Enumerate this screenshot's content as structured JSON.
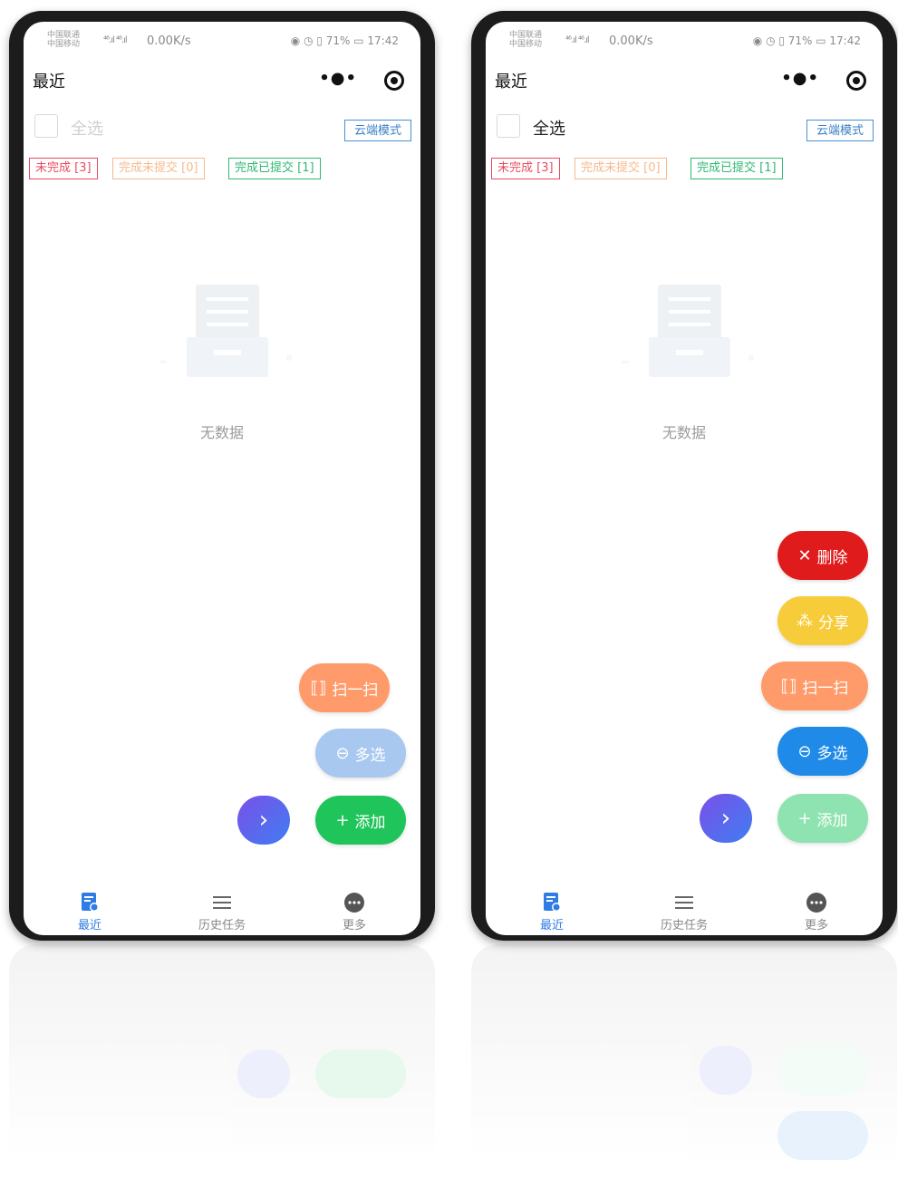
{
  "status_bar": {
    "carrier_line1": "中国联通",
    "carrier_line2": "中国移动",
    "signal": "⁴⁶.ıl ⁴⁶.ıl",
    "net_speed": "0.00K/s",
    "right_status": "◉ ◷ ▯ 71% ▭ 17:42"
  },
  "nav": {
    "title": "最近",
    "more_icon": "•●•"
  },
  "toolbar": {
    "select_all_label": "全选",
    "cloud_mode_label": "云端模式"
  },
  "filters": [
    {
      "label": "未完成 [3]",
      "color": "#e84a5f"
    },
    {
      "label": "完成未提交 [0]",
      "color": "#f5a25d"
    },
    {
      "label": "完成已提交 [1]",
      "color": "#2eb872"
    }
  ],
  "empty": {
    "text": "无数据"
  },
  "left_phone": {
    "select_all_enabled": false,
    "fabs": [
      {
        "label": "扫一扫",
        "icon": "⟦⟧",
        "color": "#ff9b6a"
      },
      {
        "label": "多选",
        "icon": "⊖",
        "color": "#a8c8f0"
      },
      {
        "label": "添加",
        "icon": "+",
        "color": "#1fc45a"
      }
    ],
    "next_icon": "›"
  },
  "right_phone": {
    "select_all_enabled": true,
    "fabs": [
      {
        "label": "删除",
        "icon": "✕",
        "color": "#e01b1b"
      },
      {
        "label": "分享",
        "icon": "⁂",
        "color": "#f7cc3a"
      },
      {
        "label": "扫一扫",
        "icon": "⟦⟧",
        "color": "#ff9b6a"
      },
      {
        "label": "多选",
        "icon": "⊖",
        "color": "#1f8ae8"
      },
      {
        "label": "添加",
        "icon": "+",
        "color": "#8fe3b0"
      }
    ],
    "next_icon": "›"
  },
  "tabbar": {
    "items": [
      {
        "label": "最近",
        "icon": "recent-doc-icon",
        "active": true
      },
      {
        "label": "历史任务",
        "icon": "list-icon",
        "active": false
      },
      {
        "label": "更多",
        "icon": "more-circle-icon",
        "active": false
      }
    ]
  },
  "colors": {
    "accent": "#2e7de6",
    "frame": "#1c1c1c"
  }
}
